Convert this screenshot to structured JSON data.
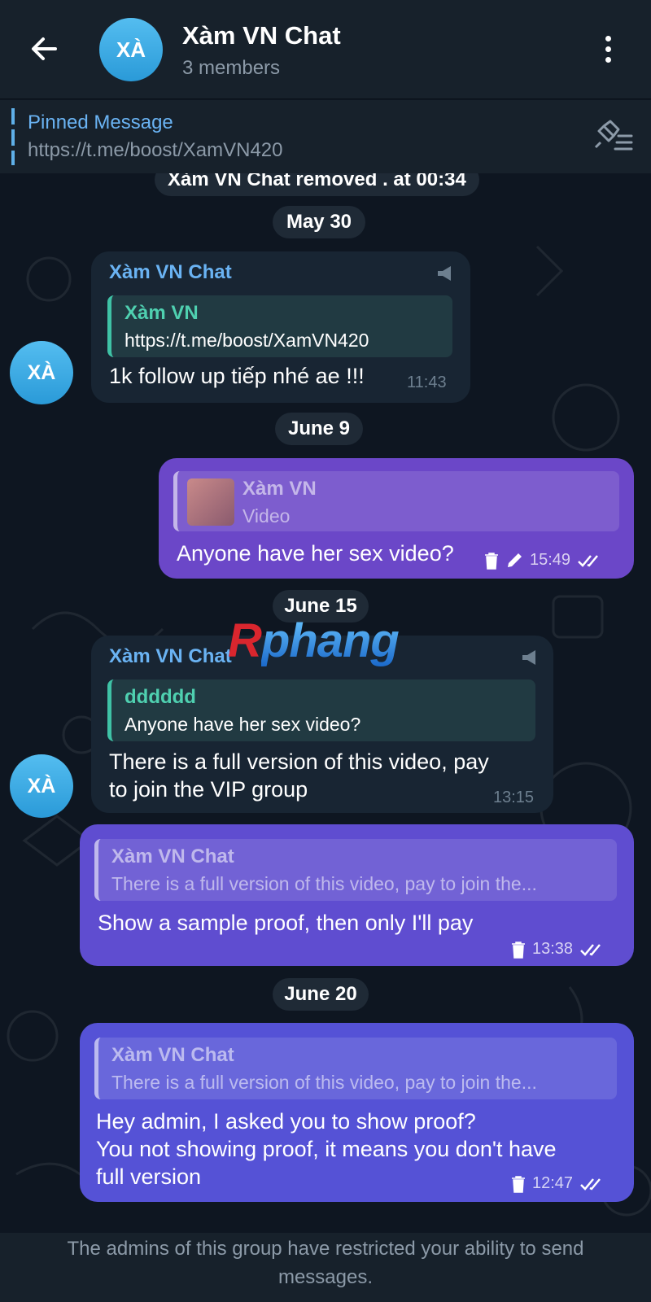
{
  "header": {
    "avatar_text": "XÀ",
    "title": "Xàm VN Chat",
    "subtitle": "3 members"
  },
  "pinned": {
    "label": "Pinned Message",
    "text": "https://t.me/boost/XamVN420"
  },
  "service_message": "Xàm VN Chat removed . at 00:34",
  "dates": [
    "May 30",
    "June 9",
    "June 15",
    "June 20"
  ],
  "messages": [
    {
      "sender": "Xàm VN Chat",
      "avatar": "XÀ",
      "quote_name": "Xàm VN",
      "quote_text": "https://t.me/boost/XamVN420",
      "text": "1k follow up tiếp nhé ae !!!",
      "time": "11:43"
    },
    {
      "quote_name": "Xàm VN",
      "quote_text": "Video",
      "text": "Anyone have her sex video?",
      "time": "15:49"
    },
    {
      "sender": "Xàm VN Chat",
      "avatar": "XÀ",
      "quote_name": "dddddd",
      "quote_text": "Anyone have her sex video?",
      "text_line1": "There is a full version of this video, pay",
      "text_line2": "to join the VIP group",
      "time": "13:15"
    },
    {
      "quote_name": "Xàm VN Chat",
      "quote_text": "There is a full version of this video, pay to join the...",
      "text": "Show a sample proof, then only I'll pay",
      "time": "13:38"
    },
    {
      "quote_name": "Xàm VN Chat",
      "quote_text": "There is a full version of this video, pay to join the...",
      "text_line1": "Hey admin, I asked you to show proof?",
      "text_line2": "You not showing proof, it means you don't have",
      "text_line3": "full version",
      "time": "12:47"
    }
  ],
  "watermark": {
    "part1": "R",
    "part2": "phang"
  },
  "footer": {
    "line1": "The admins of this group have restricted your ability to send",
    "line2": "messages."
  },
  "colors": {
    "background": "#0e1621",
    "header": "#17212b",
    "incoming_bubble": "#182533",
    "outgoing_bubble": "#6b47c8",
    "accent": "#6ab3f3"
  }
}
